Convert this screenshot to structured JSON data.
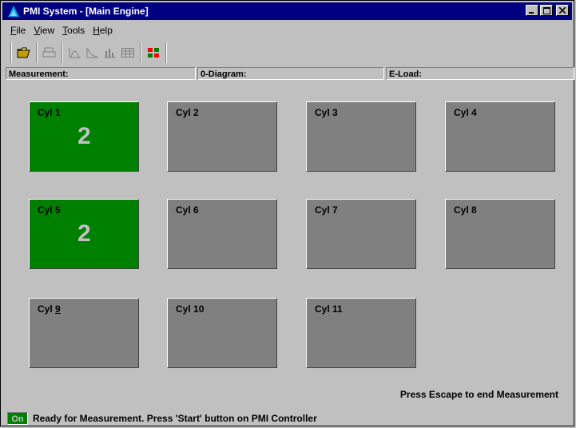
{
  "window": {
    "title": "PMI System - [Main Engine]"
  },
  "menu": [
    {
      "label": "File",
      "u": "F",
      "rest": "ile"
    },
    {
      "label": "View",
      "u": "V",
      "rest": "iew"
    },
    {
      "label": "Tools",
      "u": "T",
      "rest": "ools"
    },
    {
      "label": "Help",
      "u": "H",
      "rest": "elp"
    }
  ],
  "toolbar": {
    "icons": [
      "open-folder-icon",
      "print-icon",
      "pressure-curve-icon",
      "diagram-icon",
      "bar-chart-icon",
      "table-icon",
      "grid-colors-icon"
    ]
  },
  "info": {
    "measurement": "Measurement:",
    "diagram": "0-Diagram:",
    "eload": "E-Load:"
  },
  "cylinders": [
    {
      "prefix": "Cyl ",
      "num": "1",
      "count": "2",
      "active": true
    },
    {
      "prefix": "Cyl ",
      "num": "2",
      "count": "",
      "active": false
    },
    {
      "prefix": "Cyl ",
      "num": "3",
      "count": "",
      "active": false
    },
    {
      "prefix": "Cyl ",
      "num": "4",
      "count": "",
      "active": false
    },
    {
      "prefix": "Cyl ",
      "num": "5",
      "count": "2",
      "active": true
    },
    {
      "prefix": "Cyl ",
      "num": "6",
      "count": "",
      "active": false
    },
    {
      "prefix": "Cyl ",
      "num": "7",
      "count": "",
      "active": false
    },
    {
      "prefix": "Cyl ",
      "num": "8",
      "count": "",
      "active": false
    },
    {
      "prefix": "Cyl ",
      "num": "9",
      "count": "",
      "active": false
    },
    {
      "prefix": "Cyl ",
      "num": "10",
      "count": "",
      "active": false
    },
    {
      "prefix": "Cyl ",
      "num": "11",
      "count": "",
      "active": false
    }
  ],
  "hint": "Press Escape to end Measurement",
  "status": {
    "indicator": "On",
    "message": "Ready for Measurement. Press 'Start' button on PMI Controller"
  },
  "colors": {
    "active": "#008000",
    "inactive": "#808080",
    "titlebar": "#000080"
  }
}
